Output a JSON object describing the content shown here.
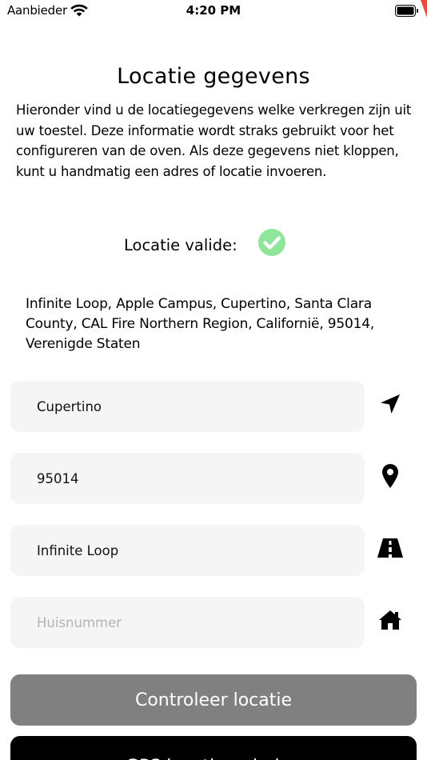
{
  "status_bar": {
    "carrier": "Aanbieder",
    "time": "4:20 PM",
    "icons": [
      "wifi-icon",
      "battery-icon"
    ]
  },
  "page": {
    "title": "Locatie gegevens",
    "intro": "Hieronder vind u de locatiegegevens welke verkregen zijn uit uw toestel. Deze informatie wordt straks gebruikt voor het configureren van de oven. Als deze gegevens niet kloppen, kunt u handmatig een adres of locatie invoeren."
  },
  "validation": {
    "label": "Locatie valide:",
    "icon": "check-circle-icon",
    "color": "#8fe59a"
  },
  "address": "Infinite Loop, Apple Campus, Cupertino, Santa Clara County, CAL Fire Northern Region, Californië, 95014, Verenigde Staten",
  "fields": {
    "city": {
      "value": "Cupertino",
      "placeholder": "",
      "icon": "navigation-arrow-icon"
    },
    "postal_code": {
      "value": "95014",
      "placeholder": "",
      "icon": "map-pin-icon"
    },
    "street": {
      "value": "Infinite Loop",
      "placeholder": "",
      "icon": "road-icon"
    },
    "house_number": {
      "value": "",
      "placeholder": "Huisnummer",
      "icon": "home-icon"
    }
  },
  "buttons": {
    "check_location": "Controleer locatie",
    "get_gps": "GPS locatie ophalen"
  },
  "colors": {
    "field_bg": "#f5f5f5",
    "check_button": "#808080",
    "gps_button": "#000000"
  }
}
